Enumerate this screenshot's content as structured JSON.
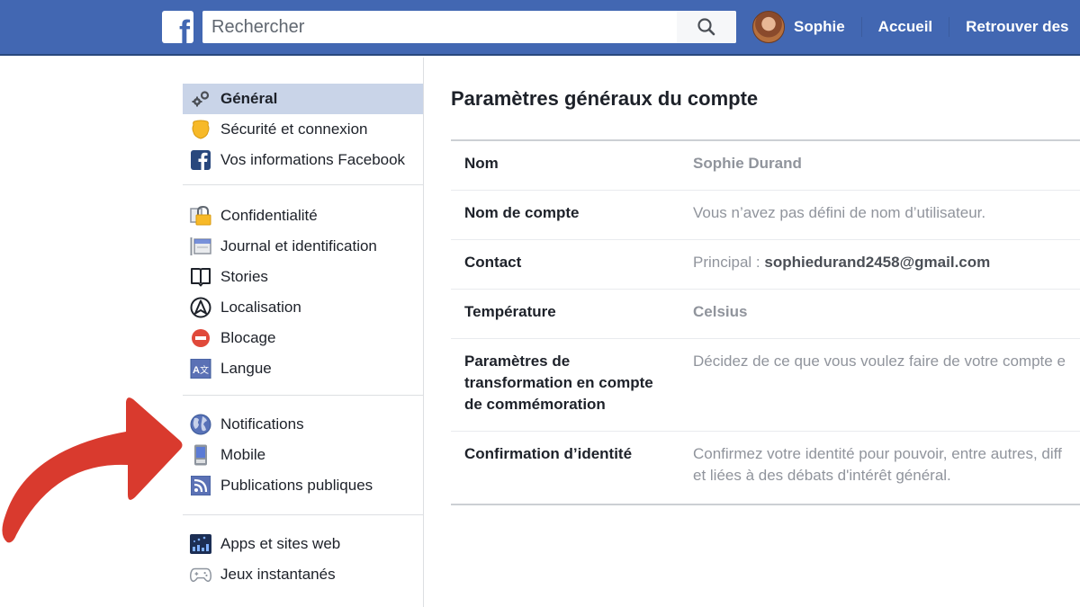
{
  "topbar": {
    "logo": "f",
    "search_placeholder": "Rechercher",
    "user_name": "Sophie",
    "nav_home": "Accueil",
    "nav_find_friends": "Retrouver des"
  },
  "sidebar": {
    "groups": [
      [
        {
          "label": "Général",
          "icon": "gears-icon",
          "active": true
        },
        {
          "label": "Sécurité et connexion",
          "icon": "shield-badge-icon"
        },
        {
          "label": "Vos informations Facebook",
          "icon": "facebook-icon"
        }
      ],
      [
        {
          "label": "Confidentialité",
          "icon": "padlock-icon"
        },
        {
          "label": "Journal et identification",
          "icon": "timeline-icon"
        },
        {
          "label": "Stories",
          "icon": "book-icon"
        },
        {
          "label": "Localisation",
          "icon": "location-icon"
        },
        {
          "label": "Blocage",
          "icon": "block-icon"
        },
        {
          "label": "Langue",
          "icon": "language-icon"
        }
      ],
      [
        {
          "label": "Notifications",
          "icon": "globe-icon"
        },
        {
          "label": "Mobile",
          "icon": "mobile-icon"
        },
        {
          "label": "Publications publiques",
          "icon": "rss-icon"
        }
      ],
      [
        {
          "label": "Apps et sites web",
          "icon": "apps-icon"
        },
        {
          "label": "Jeux instantanés",
          "icon": "gamepad-icon"
        }
      ]
    ]
  },
  "main": {
    "title": "Paramètres généraux du compte",
    "rows": [
      {
        "key": "Nom",
        "value": "Sophie Durand"
      },
      {
        "key": "Nom de compte",
        "value": "Vous n’avez pas défini de nom d’utilisateur."
      },
      {
        "key": "Contact",
        "value_prefix": "Principal : ",
        "value": "sophiedurand2458@gmail.com"
      },
      {
        "key": "Température",
        "value": "Celsius"
      },
      {
        "key": "Paramètres de transformation en compte de commémoration",
        "value": "Décidez de ce que vous voulez faire de votre compte e"
      },
      {
        "key": "Confirmation d’identité",
        "value_line1": "Confirmez votre identité pour pouvoir, entre autres, diff",
        "value_line2": "et liées à des débats d'intérêt général."
      }
    ]
  },
  "colors": {
    "brand_blue": "#4267b2",
    "active_item_bg": "#c9d4e8",
    "arrow_red": "#d93a2e"
  }
}
